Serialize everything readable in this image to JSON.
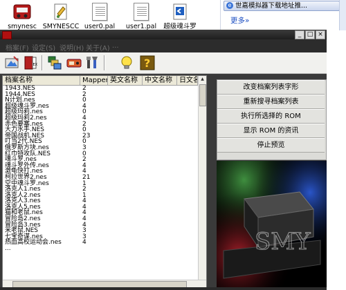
{
  "desktop": {
    "icons": [
      {
        "label": "smynesc",
        "icon": "red-car-app-icon"
      },
      {
        "label": "SMYNESCC",
        "icon": "paint-document-icon"
      },
      {
        "label": "user0.pal",
        "icon": "document-icon"
      },
      {
        "label": "user1.pal",
        "icon": "document-icon"
      },
      {
        "label": "超级魂斗罗",
        "icon": "blue-document-icon"
      }
    ]
  },
  "browser": {
    "tab_title": "世嘉模拟器下载地址推...",
    "link_text": "更多»"
  },
  "window": {
    "title": "",
    "menu": [
      "档案(F)",
      "设定(S)",
      "说明(H)",
      "关于(A)",
      "..."
    ],
    "toolbar_icons": [
      "load-rom-icon",
      "exit-door-icon",
      "copy-files-icon",
      "cartridge-icon",
      "tools-icon",
      "lightbulb-icon",
      "help-icon"
    ],
    "columns": [
      "档案名称",
      "Mapper",
      "英文名称",
      "中文名称",
      "日文名"
    ],
    "rows": [
      {
        "name": "1943.NES",
        "mapper": "2"
      },
      {
        "name": "1944.NES",
        "mapper": "2"
      },
      {
        "name": "N计划.nes",
        "mapper": "0"
      },
      {
        "name": "超级魂斗罗.nes",
        "mapper": "4"
      },
      {
        "name": "超级玛莉.nes",
        "mapper": "0"
      },
      {
        "name": "超级玛莉2.nes",
        "mapper": "4"
      },
      {
        "name": "赤色要塞.nes",
        "mapper": "2"
      },
      {
        "name": "大力水手.NES",
        "mapper": "0"
      },
      {
        "name": "帝国战机.NES",
        "mapper": "23"
      },
      {
        "name": "叮当2代.NES",
        "mapper": "0"
      },
      {
        "name": "俄罗斯方块.nes",
        "mapper": "3"
      },
      {
        "name": "红巾特攻队.NES",
        "mapper": "0"
      },
      {
        "name": "魂斗罗.nes",
        "mapper": "2"
      },
      {
        "name": "魂斗罗外传.nes",
        "mapper": "4"
      },
      {
        "name": "激龟快打.nes",
        "mapper": "4"
      },
      {
        "name": "柯拉世界2.nes",
        "mapper": "21"
      },
      {
        "name": "空中魂斗罗.nes",
        "mapper": "1"
      },
      {
        "name": "洛克人1.nes",
        "mapper": "2"
      },
      {
        "name": "洛克人2.nes",
        "mapper": "1"
      },
      {
        "name": "洛克人3.nes",
        "mapper": "4"
      },
      {
        "name": "洛克人5.nes",
        "mapper": "4"
      },
      {
        "name": "猫和老鼠.nes",
        "mapper": "4"
      },
      {
        "name": "冒险岛2.nes",
        "mapper": "4"
      },
      {
        "name": "冒险岛3.nes",
        "mapper": "4"
      },
      {
        "name": "米老鼠.NES",
        "mapper": "3"
      },
      {
        "name": "七宝奇谋.nes",
        "mapper": "3"
      },
      {
        "name": "热血高校运动会.nes",
        "mapper": "4"
      },
      {
        "name": "...",
        "mapper": ""
      }
    ],
    "actions": [
      "改变档案列表字形",
      "重新搜寻档案列表",
      "执行所选择的 ROM",
      "显示 ROM 的资讯",
      "停止预览"
    ]
  },
  "colors": {
    "window_frame": "#3a3a3a",
    "toolbar_bg": "#f1f1ee",
    "button_face": "#e3e3df",
    "link": "#1d4fc2"
  }
}
